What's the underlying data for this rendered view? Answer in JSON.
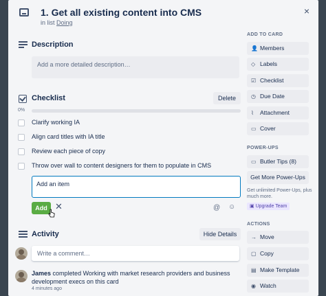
{
  "card": {
    "title": "1. Get all existing content into CMS",
    "in_list_prefix": "in list",
    "list_name": "Doing",
    "close": "×"
  },
  "description": {
    "title": "Description",
    "placeholder": "Add a more detailed description…"
  },
  "checklist": {
    "title": "Checklist",
    "delete_label": "Delete",
    "progress_text": "0%",
    "progress_value": 0,
    "items": [
      {
        "text": "Clarify working IA",
        "checked": false
      },
      {
        "text": "Align card titles with IA title",
        "checked": false
      },
      {
        "text": "Review each piece of copy",
        "checked": false
      },
      {
        "text": "Throw over wall to content designers for them to populate in CMS",
        "checked": false
      }
    ],
    "new_item_value": "Add an item",
    "add_label": "Add",
    "cancel_label": "✕",
    "mention_label": "@",
    "emoji_label": "☺"
  },
  "activity": {
    "title": "Activity",
    "hide_details_label": "Hide Details",
    "comment_placeholder": "Write a comment…",
    "entries": [
      {
        "user": "James",
        "text": "completed Working with market research providers and business development execs on this card",
        "time": "4 minutes ago"
      }
    ]
  },
  "sidebar": {
    "add_to_card_heading": "ADD TO CARD",
    "add_to_card": [
      {
        "label": "Members",
        "icon": "person-icon"
      },
      {
        "label": "Labels",
        "icon": "tag-icon"
      },
      {
        "label": "Checklist",
        "icon": "checklist-icon"
      },
      {
        "label": "Due Date",
        "icon": "clock-icon"
      },
      {
        "label": "Attachment",
        "icon": "paperclip-icon"
      },
      {
        "label": "Cover",
        "icon": "cover-icon"
      }
    ],
    "powerups_heading": "POWER-UPS",
    "butler_label": "Butler Tips (8)",
    "more_powerups_label": "Get More Power-Ups",
    "powerups_note": "Get unlimited Power-Ups, plus much more.",
    "upgrade_label": "Upgrade Team",
    "actions_heading": "ACTIONS",
    "actions": [
      {
        "label": "Move",
        "icon": "arrow-right-icon"
      },
      {
        "label": "Copy",
        "icon": "copy-icon"
      },
      {
        "label": "Make Template",
        "icon": "template-icon"
      },
      {
        "label": "Watch",
        "icon": "eye-icon"
      }
    ]
  },
  "colors": {
    "accent_blue": "#0079bf",
    "add_green": "#5aac44",
    "modal_bg": "#f4f5f7",
    "upgrade_purple": "#5243aa"
  }
}
